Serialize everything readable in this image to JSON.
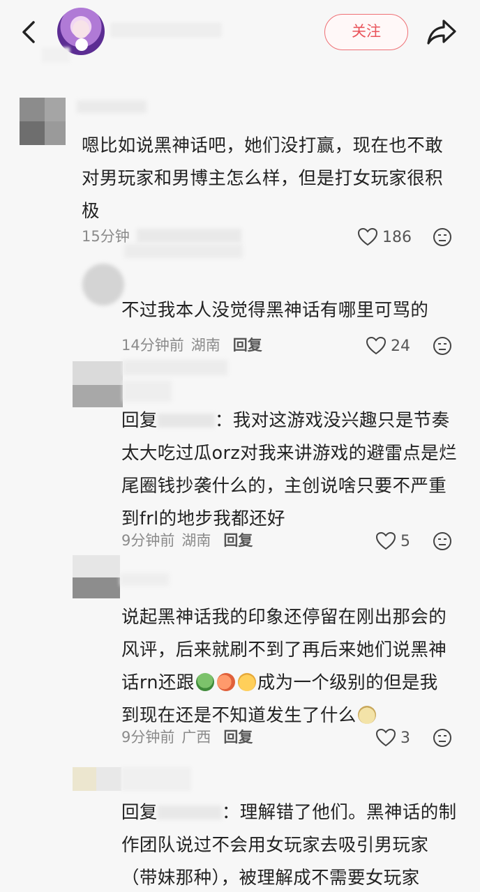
{
  "header": {
    "follow_label": "关注"
  },
  "comments": [
    {
      "text": "嗯比如说黑神话吧，她们没打赢，现在也不敢对男玩家和男博主怎么样，但是打女玩家很积极",
      "time": "15分钟",
      "likes": "186"
    },
    {
      "text": "不过我本人没觉得黑神话有哪里可骂的",
      "time": "14分钟前",
      "location": "湖南",
      "reply_label": "回复",
      "likes": "24"
    },
    {
      "text_prefix": "回复",
      "text_main": "：我对这游戏没兴趣只是节奏太大吃过瓜orz对我来讲游戏的避雷点是烂尾圈钱抄袭什么的，主创说啥只要不严重到frl的地步我都还好",
      "time": "9分钟前",
      "location": "湖南",
      "reply_label": "回复",
      "likes": "5"
    },
    {
      "line1": "说起黑神话我的印象还停留在刚出那会的",
      "line2": "风评，后来就刷不到了再后来她们说黑神",
      "line3a": "话rn还跟",
      "line3b": "成为一个级别的但是我",
      "line4": "到现在还是不知道发生了什么",
      "time": "9分钟前",
      "location": "广西",
      "reply_label": "回复",
      "likes": "3"
    },
    {
      "text_prefix": "回复",
      "text_main": "：理解错了他们。黑神话的制作团队说过不会用女玩家去吸引男玩家（带妹那种），被理解成不需要女玩家"
    }
  ],
  "colors": {
    "accent": "#e9545b",
    "background": "#f7f7f7"
  }
}
